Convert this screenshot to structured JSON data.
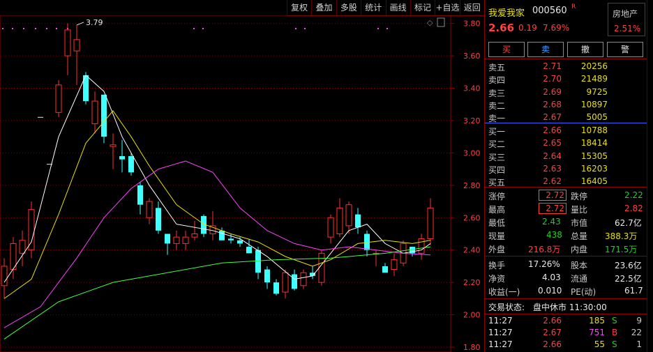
{
  "toolbar": [
    "复权",
    "叠加",
    "多股",
    "统计",
    "画线",
    "标记",
    "+自选",
    "返回"
  ],
  "stock": {
    "name": "我爱我家",
    "code": "000560",
    "flag": "R",
    "price": "2.66",
    "change": "0.19",
    "pct": "7.69%",
    "sector": "房地产",
    "sector_pct": "2.51%"
  },
  "actions": [
    "买",
    "卖",
    "撤",
    "警"
  ],
  "sell_levels": [
    {
      "label": "卖五",
      "price": "2.71",
      "vol": "20256"
    },
    {
      "label": "卖四",
      "price": "2.70",
      "vol": "21489"
    },
    {
      "label": "卖三",
      "price": "2.69",
      "vol": "9725"
    },
    {
      "label": "卖二",
      "price": "2.68",
      "vol": "10897"
    },
    {
      "label": "卖一",
      "price": "2.67",
      "vol": "5005"
    }
  ],
  "buy_levels": [
    {
      "label": "买一",
      "price": "2.66",
      "vol": "10788"
    },
    {
      "label": "买二",
      "price": "2.65",
      "vol": "18414"
    },
    {
      "label": "买三",
      "price": "2.64",
      "vol": "15305"
    },
    {
      "label": "买四",
      "price": "2.63",
      "vol": "16203"
    },
    {
      "label": "买五",
      "price": "2.62",
      "vol": "16405"
    }
  ],
  "quote": {
    "limit_up_label": "涨停",
    "limit_up": "2.72",
    "limit_down_label": "跌停",
    "limit_down": "2.22",
    "high_label": "最高",
    "high": "2.72",
    "vol_ratio_label": "量比",
    "vol_ratio": "2.82",
    "low_label": "最低",
    "low": "2.43",
    "mktcap_label": "市值",
    "mktcap": "62.7亿",
    "now_label": "现量",
    "now": "438",
    "total_label": "总量",
    "total": "388.3万",
    "outer_label": "外盘",
    "outer": "216.8万",
    "inner_label": "内盘",
    "inner": "171.5万",
    "turnover_label": "换手",
    "turnover": "17.26%",
    "shares_label": "股本",
    "shares": "23.6亿",
    "nav_label": "净资",
    "nav": "4.03",
    "float_label": "流通",
    "float": "22.5亿",
    "eps_label": "收益(一)",
    "eps": "0.010",
    "pe_label": "PE(动)",
    "pe": "61.7"
  },
  "status": {
    "label": "交易状态:",
    "value": "盘中休市 11:30:00"
  },
  "ticks": [
    {
      "time": "11:27",
      "price": "2.66",
      "vol": "185",
      "side": "S",
      "count": "9"
    },
    {
      "time": "11:27",
      "price": "2.67",
      "vol": "751",
      "side": "B",
      "count": "22"
    },
    {
      "time": "11:27",
      "price": "2.66",
      "vol": "55",
      "side": "S",
      "count": "1"
    }
  ],
  "chart_data": {
    "type": "candlestick",
    "y_ticks": [
      "3.80",
      "3.60",
      "3.40",
      "3.20",
      "3.00",
      "2.80",
      "2.60",
      "2.40",
      "2.20",
      "2.00",
      "1.80"
    ],
    "ylim": [
      1.77,
      3.85
    ],
    "annotation": "3.79",
    "candles": [
      {
        "o": 2.18,
        "h": 2.35,
        "l": 2.1,
        "c": 2.3
      },
      {
        "o": 2.28,
        "h": 2.48,
        "l": 2.22,
        "c": 2.44
      },
      {
        "o": 2.38,
        "h": 2.52,
        "l": 2.3,
        "c": 2.46
      },
      {
        "o": 2.4,
        "h": 2.7,
        "l": 2.35,
        "c": 2.65
      },
      {
        "o": 3.22,
        "h": 3.22,
        "l": 3.22,
        "c": 3.22
      },
      {
        "o": 2.93,
        "h": 2.93,
        "l": 2.93,
        "c": 2.93
      },
      {
        "o": 3.25,
        "h": 3.45,
        "l": 3.22,
        "c": 3.42
      },
      {
        "o": 3.6,
        "h": 3.8,
        "l": 3.48,
        "c": 3.76
      },
      {
        "o": 3.63,
        "h": 3.79,
        "l": 3.42,
        "c": 3.7
      },
      {
        "o": 3.48,
        "h": 3.5,
        "l": 3.3,
        "c": 3.32
      },
      {
        "o": 3.18,
        "h": 3.38,
        "l": 3.12,
        "c": 3.32
      },
      {
        "o": 3.36,
        "h": 3.36,
        "l": 3.06,
        "c": 3.1
      },
      {
        "o": 3.04,
        "h": 3.12,
        "l": 2.9,
        "c": 3.05
      },
      {
        "o": 2.98,
        "h": 3.08,
        "l": 2.88,
        "c": 2.96
      },
      {
        "o": 2.98,
        "h": 3.0,
        "l": 2.86,
        "c": 2.88
      },
      {
        "o": 2.8,
        "h": 2.82,
        "l": 2.62,
        "c": 2.68
      },
      {
        "o": 2.6,
        "h": 2.72,
        "l": 2.56,
        "c": 2.7
      },
      {
        "o": 2.66,
        "h": 2.7,
        "l": 2.5,
        "c": 2.52
      },
      {
        "o": 2.5,
        "h": 2.5,
        "l": 2.37,
        "c": 2.44
      },
      {
        "o": 2.44,
        "h": 2.52,
        "l": 2.4,
        "c": 2.48
      },
      {
        "o": 2.44,
        "h": 2.52,
        "l": 2.4,
        "c": 2.48
      },
      {
        "o": 2.48,
        "h": 2.58,
        "l": 2.46,
        "c": 2.5
      },
      {
        "o": 2.61,
        "h": 2.62,
        "l": 2.48,
        "c": 2.5
      },
      {
        "o": 2.5,
        "h": 2.64,
        "l": 2.46,
        "c": 2.55
      },
      {
        "o": 2.52,
        "h": 2.54,
        "l": 2.46,
        "c": 2.46
      },
      {
        "o": 2.47,
        "h": 2.5,
        "l": 2.44,
        "c": 2.46
      },
      {
        "o": 2.46,
        "h": 2.48,
        "l": 2.42,
        "c": 2.44
      },
      {
        "o": 2.42,
        "h": 2.47,
        "l": 2.38,
        "c": 2.38
      },
      {
        "o": 2.4,
        "h": 2.42,
        "l": 2.22,
        "c": 2.26
      },
      {
        "o": 2.28,
        "h": 2.3,
        "l": 2.16,
        "c": 2.2
      },
      {
        "o": 2.2,
        "h": 2.22,
        "l": 2.12,
        "c": 2.13
      },
      {
        "o": 2.14,
        "h": 2.28,
        "l": 2.1,
        "c": 2.26
      },
      {
        "o": 2.25,
        "h": 2.28,
        "l": 2.15,
        "c": 2.16
      },
      {
        "o": 2.18,
        "h": 2.28,
        "l": 2.16,
        "c": 2.26
      },
      {
        "o": 2.26,
        "h": 2.3,
        "l": 2.22,
        "c": 2.24
      },
      {
        "o": 2.2,
        "h": 2.4,
        "l": 2.18,
        "c": 2.38
      },
      {
        "o": 2.48,
        "h": 2.62,
        "l": 2.44,
        "c": 2.6
      },
      {
        "o": 2.5,
        "h": 2.72,
        "l": 2.48,
        "c": 2.66
      },
      {
        "o": 2.55,
        "h": 2.7,
        "l": 2.5,
        "c": 2.68
      },
      {
        "o": 2.62,
        "h": 2.66,
        "l": 2.5,
        "c": 2.54
      },
      {
        "o": 2.5,
        "h": 2.52,
        "l": 2.36,
        "c": 2.4
      },
      {
        "o": 2.38,
        "h": 2.4,
        "l": 2.3,
        "c": 2.38
      },
      {
        "o": 2.3,
        "h": 2.32,
        "l": 2.26,
        "c": 2.26
      },
      {
        "o": 2.28,
        "h": 2.38,
        "l": 2.24,
        "c": 2.34
      },
      {
        "o": 2.32,
        "h": 2.46,
        "l": 2.3,
        "c": 2.44
      },
      {
        "o": 2.42,
        "h": 2.42,
        "l": 2.36,
        "c": 2.38
      },
      {
        "o": 2.38,
        "h": 2.5,
        "l": 2.34,
        "c": 2.47
      },
      {
        "o": 2.47,
        "h": 2.72,
        "l": 2.43,
        "c": 2.66
      }
    ],
    "ma": [
      {
        "color": "#ffffff",
        "points": [
          [
            0,
            2.2
          ],
          [
            3,
            2.45
          ],
          [
            6,
            3.1
          ],
          [
            9,
            3.48
          ],
          [
            11,
            3.38
          ],
          [
            13,
            3.1
          ],
          [
            16,
            2.8
          ],
          [
            19,
            2.56
          ],
          [
            23,
            2.52
          ],
          [
            26,
            2.47
          ],
          [
            29,
            2.36
          ],
          [
            32,
            2.22
          ],
          [
            34,
            2.24
          ],
          [
            36,
            2.38
          ],
          [
            38,
            2.52
          ],
          [
            40,
            2.56
          ],
          [
            42,
            2.44
          ],
          [
            44,
            2.38
          ],
          [
            46,
            2.4
          ],
          [
            47,
            2.44
          ]
        ]
      },
      {
        "color": "#e8e000",
        "points": [
          [
            0,
            2.1
          ],
          [
            3,
            2.22
          ],
          [
            6,
            2.62
          ],
          [
            9,
            3.06
          ],
          [
            12,
            3.26
          ],
          [
            14,
            3.1
          ],
          [
            16,
            2.92
          ],
          [
            19,
            2.68
          ],
          [
            22,
            2.56
          ],
          [
            25,
            2.5
          ],
          [
            28,
            2.45
          ],
          [
            31,
            2.36
          ],
          [
            34,
            2.3
          ],
          [
            36,
            2.34
          ],
          [
            39,
            2.44
          ],
          [
            42,
            2.46
          ],
          [
            45,
            2.44
          ],
          [
            47,
            2.46
          ]
        ]
      },
      {
        "color": "#ff40ff",
        "points": [
          [
            0,
            1.92
          ],
          [
            4,
            2.05
          ],
          [
            8,
            2.35
          ],
          [
            11,
            2.6
          ],
          [
            14,
            2.78
          ],
          [
            17,
            2.9
          ],
          [
            20,
            2.95
          ],
          [
            23,
            2.88
          ],
          [
            26,
            2.66
          ],
          [
            29,
            2.52
          ],
          [
            32,
            2.44
          ],
          [
            35,
            2.4
          ],
          [
            38,
            2.42
          ],
          [
            41,
            2.4
          ],
          [
            44,
            2.38
          ],
          [
            47,
            2.37
          ]
        ]
      },
      {
        "color": "#40ff40",
        "points": [
          [
            0,
            1.85
          ],
          [
            6,
            2.08
          ],
          [
            12,
            2.2
          ],
          [
            18,
            2.26
          ],
          [
            24,
            2.32
          ],
          [
            30,
            2.34
          ],
          [
            36,
            2.35
          ],
          [
            42,
            2.38
          ],
          [
            47,
            2.42
          ]
        ]
      }
    ]
  }
}
